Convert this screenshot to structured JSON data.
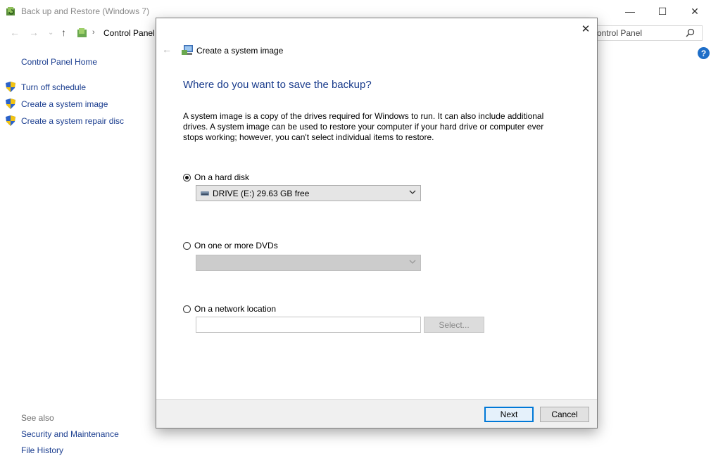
{
  "window": {
    "title": "Back up and Restore (Windows 7)",
    "minimize": "—",
    "maximize": "☐",
    "close": "✕"
  },
  "address": {
    "breadcrumb": "Control Panel",
    "search_placeholder": "ontrol Panel"
  },
  "sidebar": {
    "home": "Control Panel Home",
    "items": [
      {
        "label": "Turn off schedule"
      },
      {
        "label": "Create a system image"
      },
      {
        "label": "Create a system repair disc"
      }
    ],
    "see_also_title": "See also",
    "see_also": [
      {
        "label": "Security and Maintenance"
      },
      {
        "label": "File History"
      }
    ]
  },
  "dialog": {
    "title": "Create a system image",
    "heading": "Where do you want to save the backup?",
    "description": "A system image is a copy of the drives required for Windows to run. It can also include additional drives. A system image can be used to restore your computer if your hard drive or computer ever stops working; however, you can't select individual items to restore.",
    "options": {
      "hard_disk": {
        "label": "On a hard disk",
        "selected": true,
        "value": "DRIVE (E:)  29.63 GB free"
      },
      "dvd": {
        "label": "On one or more DVDs",
        "selected": false,
        "value": ""
      },
      "network": {
        "label": "On a network location",
        "selected": false,
        "value": "",
        "select_button": "Select..."
      }
    },
    "buttons": {
      "next": "Next",
      "cancel": "Cancel"
    }
  },
  "colors": {
    "link": "#1a3d8f",
    "heading": "#1a3c8c",
    "accent": "#0078d7"
  }
}
